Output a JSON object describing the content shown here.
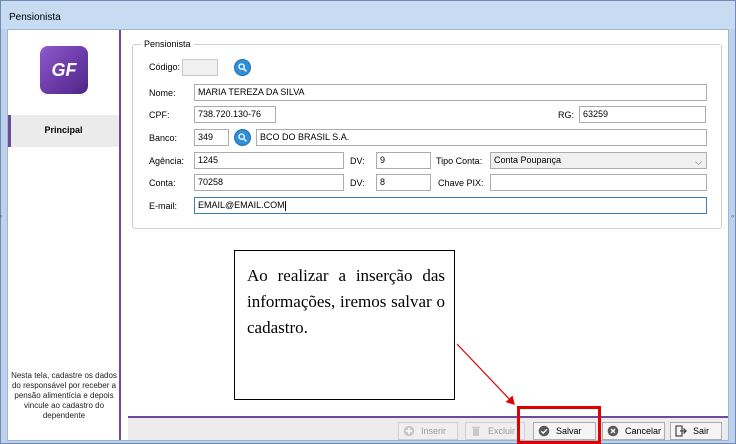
{
  "window": {
    "title": "Pensionista"
  },
  "sidebar": {
    "logo_text": "GF",
    "nav_item": "Principal",
    "help_text": "Nesta tela, cadastre os dados do responsável por receber a pensão alimentícia e depois vincule ao cadastro do dependente"
  },
  "form": {
    "group_title": "Pensionista",
    "codigo": {
      "label": "Código:",
      "value": ""
    },
    "nome": {
      "label": "Nome:",
      "value": "MARIA TEREZA DA SILVA"
    },
    "cpf": {
      "label": "CPF:",
      "value": "738.720.130-76"
    },
    "rg": {
      "label": "RG:",
      "value": "63259"
    },
    "banco": {
      "label": "Banco:",
      "code": "349",
      "name": "BCO DO BRASIL S.A."
    },
    "agencia": {
      "label": "Agência:",
      "value": "1245"
    },
    "agencia_dv": {
      "label": "DV:",
      "value": "9"
    },
    "tipo_conta": {
      "label": "Tipo Conta:",
      "value": "Conta Poupança"
    },
    "conta": {
      "label": "Conta:",
      "value": "70258"
    },
    "conta_dv": {
      "label": "DV:",
      "value": "8"
    },
    "chave_pix": {
      "label": "Chave PIX:",
      "value": ""
    },
    "email": {
      "label": "E-mail:",
      "value": "EMAIL@EMAIL.COM"
    }
  },
  "callout": {
    "text": "Ao realizar a inserção das informações, iremos salvar o cadastro."
  },
  "toolbar": {
    "inserir": "Inserir",
    "excluir": "Excluir",
    "salvar": "Salvar",
    "cancelar": "Cancelar",
    "sair": "Sair"
  },
  "colors": {
    "accent_purple": "#6d4a9c",
    "search_blue": "#2f8fd8",
    "highlight_red": "#e00000"
  }
}
